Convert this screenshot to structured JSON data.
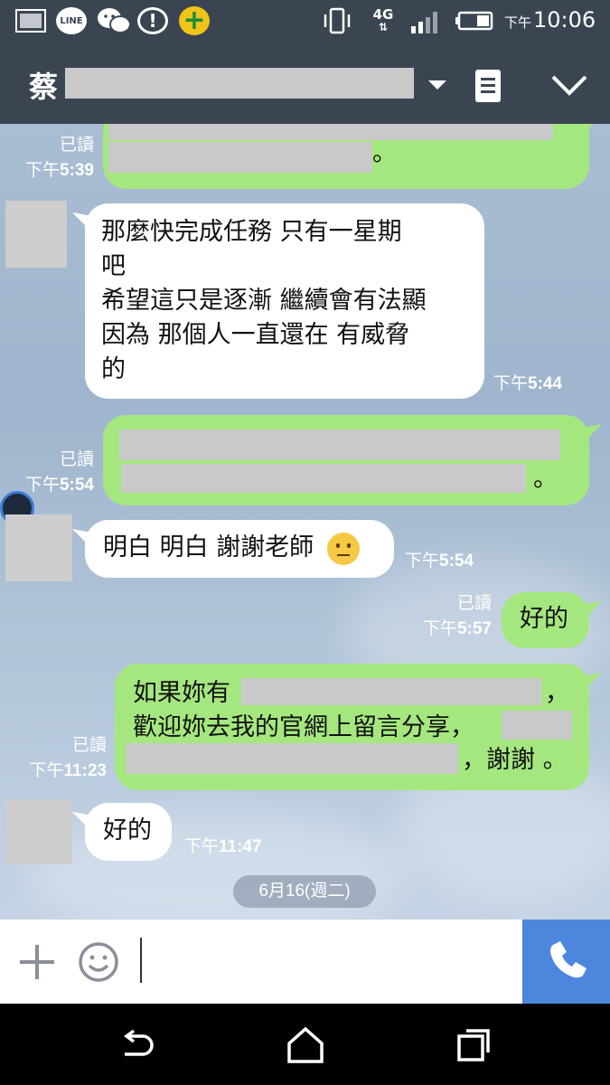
{
  "status_bar": {
    "time_prefix": "下午",
    "time": "10:06",
    "network": "4G",
    "icons": [
      "gallery-icon",
      "line-app-icon",
      "wechat-icon",
      "alert-icon",
      "plus-app-icon",
      "vibrate-icon",
      "network-4g-icon",
      "signal-icon",
      "battery-icon"
    ],
    "line_label": "LINE"
  },
  "header": {
    "title": "蔡",
    "icons": [
      "chevron-down-icon",
      "notes-icon",
      "collapse-icon"
    ]
  },
  "messages": [
    {
      "side": "out",
      "text": "。",
      "read": "已讀",
      "time_prefix": "下午",
      "time": "5:39"
    },
    {
      "side": "in",
      "lines": [
        "那麼快完成任務 只有一星期",
        "吧",
        "希望這只是逐漸 繼續會有法顯",
        "因為 那個人一直還在 有威脅",
        "的"
      ],
      "time_prefix": "下午",
      "time": "5:44"
    },
    {
      "side": "out",
      "text": "。",
      "read": "已讀",
      "time_prefix": "下午",
      "time": "5:54"
    },
    {
      "side": "in",
      "text": "明白 明白 謝謝老師",
      "emoji": "😐",
      "time_prefix": "下午",
      "time": "5:54"
    },
    {
      "side": "out",
      "text": "好的",
      "read": "已讀",
      "time_prefix": "下午",
      "time": "5:57"
    },
    {
      "side": "out",
      "line1": "如果妳有",
      "line1_end": "，",
      "line2": "歡迎妳去我的官網上留言分享，",
      "line3_end": "，謝謝 。",
      "read": "已讀",
      "time_prefix": "下午",
      "time": "11:23"
    },
    {
      "side": "in",
      "text": "好的",
      "time_prefix": "下午",
      "time": "11:47"
    }
  ],
  "date_divider": "6月16(週二)",
  "input_bar": {
    "icons": [
      "plus-icon",
      "emoji-icon",
      "phone-icon"
    ]
  },
  "nav_bar": {
    "icons": [
      "back-icon",
      "home-icon",
      "recents-icon"
    ]
  },
  "colors": {
    "header_bg": "#3b4552",
    "outgoing_bubble": "#a5e77f",
    "incoming_bubble": "#ffffff",
    "call_button": "#4d86dd"
  }
}
